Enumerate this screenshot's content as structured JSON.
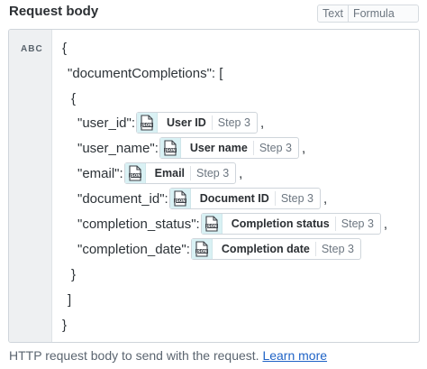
{
  "header": {
    "title": "Request body",
    "mode_options": [
      "Text",
      "Formula"
    ]
  },
  "editor": {
    "type_label": "ABC",
    "lines": [
      {
        "text": "{"
      },
      {
        "text": "\"documentCompletions\": ["
      },
      {
        "text": "{"
      },
      {
        "text": "\"user_id\":",
        "pill": {
          "label": "User ID",
          "step": "Step 3"
        },
        "suffix": ","
      },
      {
        "text": "\"user_name\":",
        "pill": {
          "label": "User name",
          "step": "Step 3"
        },
        "suffix": ","
      },
      {
        "text": "\"email\":",
        "pill": {
          "label": "Email",
          "step": "Step 3"
        },
        "suffix": ","
      },
      {
        "text": "\"document_id\":",
        "pill": {
          "label": "Document ID",
          "step": "Step 3"
        },
        "suffix": ","
      },
      {
        "text": "\"completion_status\":",
        "pill": {
          "label": "Completion status",
          "step": "Step 3"
        },
        "suffix": ","
      },
      {
        "text": "\"completion_date\":",
        "pill": {
          "label": "Completion date",
          "step": "Step 3"
        },
        "suffix": ""
      },
      {
        "text": "}"
      },
      {
        "text": "]"
      },
      {
        "text": "}"
      }
    ]
  },
  "pill_icon": {
    "name": "json-icon",
    "text": "JSON",
    "color": "#d9f1f4"
  },
  "footer": {
    "description": "HTTP request body to send with the request.",
    "link_label": "Learn more"
  },
  "colors": {
    "link": "#1f63c6",
    "pill_icon_bg": "#d9f1f4",
    "border": "#cfd5db"
  }
}
